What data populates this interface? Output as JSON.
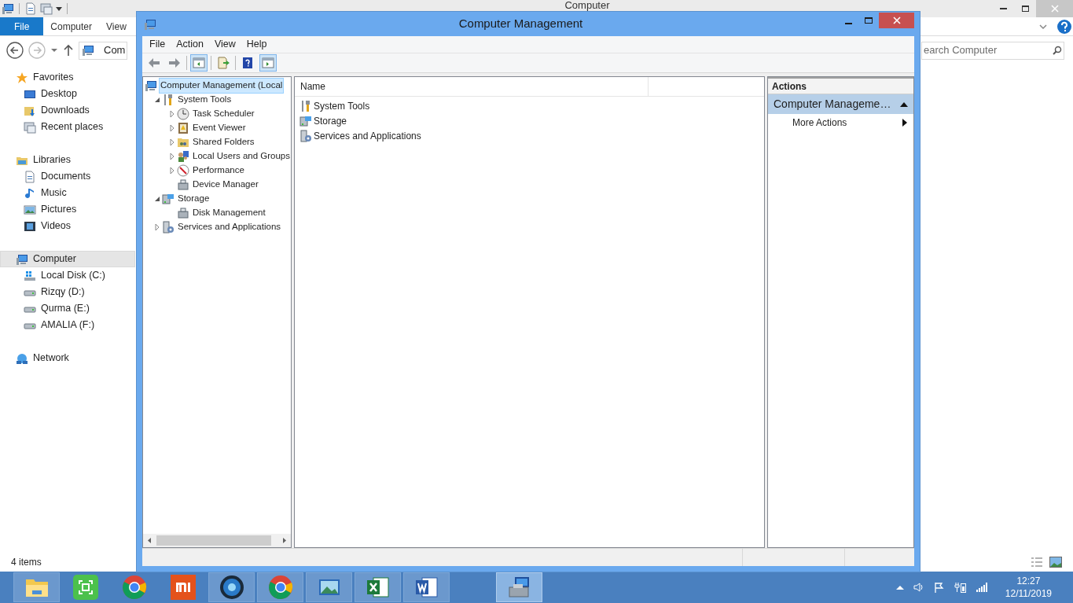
{
  "explorer": {
    "title": "Computer",
    "ribbon_tabs": [
      {
        "label": "File",
        "selected": true
      },
      {
        "label": "Computer",
        "selected": false
      },
      {
        "label": "View",
        "selected": false
      }
    ],
    "address": "Com",
    "search": {
      "placeholder": "earch Computer"
    },
    "nav": [
      {
        "label": "Favorites",
        "kind": "star",
        "group": true,
        "selected": false
      },
      {
        "label": "Desktop",
        "kind": "desktop",
        "group": false,
        "selected": false
      },
      {
        "label": "Downloads",
        "kind": "download",
        "group": false,
        "selected": false
      },
      {
        "label": "Recent places",
        "kind": "recent",
        "group": false,
        "selected": false
      },
      {
        "label": "Libraries",
        "kind": "library",
        "group": true,
        "selected": false
      },
      {
        "label": "Documents",
        "kind": "document",
        "group": false,
        "selected": false
      },
      {
        "label": "Music",
        "kind": "music",
        "group": false,
        "selected": false
      },
      {
        "label": "Pictures",
        "kind": "pictures",
        "group": false,
        "selected": false
      },
      {
        "label": "Videos",
        "kind": "videos",
        "group": false,
        "selected": false
      },
      {
        "label": "Computer",
        "kind": "computer",
        "group": true,
        "selected": true
      },
      {
        "label": "Local Disk (C:)",
        "kind": "windrive",
        "group": false,
        "selected": false
      },
      {
        "label": "Rizqy (D:)",
        "kind": "drive",
        "group": false,
        "selected": false
      },
      {
        "label": "Qurma (E:)",
        "kind": "drive",
        "group": false,
        "selected": false
      },
      {
        "label": "AMALIA (F:)",
        "kind": "drive",
        "group": false,
        "selected": false
      },
      {
        "label": "Network",
        "kind": "network",
        "group": true,
        "selected": false
      }
    ],
    "status": "4 items"
  },
  "window": {
    "title": "Computer Management",
    "menu": [
      "File",
      "Action",
      "View",
      "Help"
    ],
    "toolbar": [
      {
        "kind": "back",
        "selected": false
      },
      {
        "kind": "forward",
        "selected": false
      },
      {
        "kind": "pane-left",
        "selected": true
      },
      {
        "kind": "export",
        "selected": false
      },
      {
        "kind": "help",
        "selected": false
      },
      {
        "kind": "pane-right",
        "selected": true
      }
    ],
    "tree": [
      {
        "label": "Computer Management (Local",
        "kind": "computer",
        "selected": true,
        "children": [
          {
            "label": "System Tools",
            "kind": "tools",
            "selected": false,
            "expanded": true,
            "children": [
              {
                "label": "Task Scheduler",
                "kind": "clock",
                "selected": false,
                "expanded": false
              },
              {
                "label": "Event Viewer",
                "kind": "log",
                "selected": false,
                "expanded": false
              },
              {
                "label": "Shared Folders",
                "kind": "share",
                "selected": false,
                "expanded": false
              },
              {
                "label": "Local Users and Groups",
                "kind": "users",
                "selected": false,
                "expanded": false
              },
              {
                "label": "Performance",
                "kind": "gauge",
                "selected": false,
                "expanded": false
              },
              {
                "label": "Device Manager",
                "kind": "device",
                "selected": false
              }
            ]
          },
          {
            "label": "Storage",
            "kind": "storage",
            "selected": false,
            "expanded": true,
            "children": [
              {
                "label": "Disk Management",
                "kind": "device",
                "selected": false
              }
            ]
          },
          {
            "label": "Services and Applications",
            "kind": "services",
            "selected": false,
            "expanded": false
          }
        ]
      }
    ],
    "list": {
      "columns": [
        "Name"
      ],
      "rows": [
        {
          "label": "System Tools",
          "kind": "tools"
        },
        {
          "label": "Storage",
          "kind": "storage"
        },
        {
          "label": "Services and Applications",
          "kind": "services"
        }
      ]
    },
    "actions": {
      "title": "Actions",
      "section": "Computer Manageme…",
      "items": [
        "More Actions"
      ]
    }
  },
  "taskbar": {
    "apps": [
      {
        "kind": "explorer",
        "running": true,
        "selected": false
      },
      {
        "kind": "screenshot",
        "running": false,
        "selected": false
      },
      {
        "kind": "chrome",
        "running": false,
        "selected": false
      },
      {
        "kind": "mi",
        "running": false,
        "selected": false
      },
      {
        "kind": "disc",
        "running": true,
        "selected": false
      },
      {
        "kind": "chrome",
        "running": true,
        "selected": false
      },
      {
        "kind": "photos",
        "running": true,
        "selected": false
      },
      {
        "kind": "excel",
        "running": true,
        "selected": false
      },
      {
        "kind": "word",
        "running": true,
        "selected": false
      },
      {
        "kind": "management",
        "running": true,
        "selected": true
      }
    ],
    "time": "12:27",
    "date": "12/11/2019"
  }
}
